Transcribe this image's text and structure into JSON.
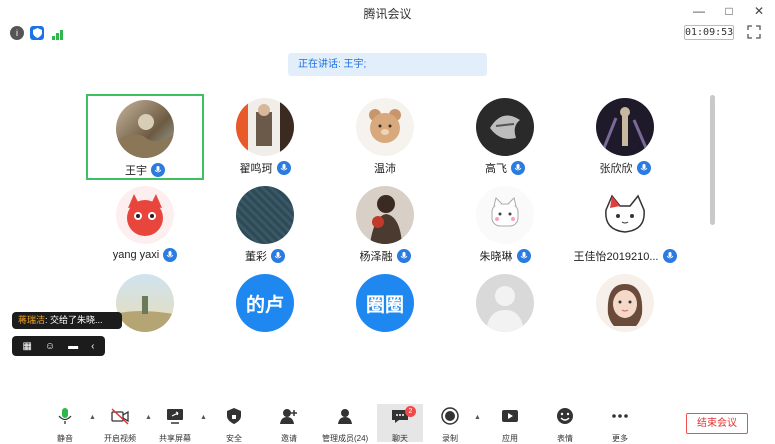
{
  "window": {
    "title": "腾讯会议",
    "minimize": "—",
    "maximize": "□",
    "close": "✕"
  },
  "meeting": {
    "duration": "01:09:53",
    "speaking_label": "正在讲话: 王宇;"
  },
  "participants": [
    {
      "name": "王宇",
      "active": true
    },
    {
      "name": "翟鸣珂"
    },
    {
      "name": "温沛"
    },
    {
      "name": "高飞"
    },
    {
      "name": "张欣欣"
    },
    {
      "name": "yang yaxi"
    },
    {
      "name": "董彩"
    },
    {
      "name": "杨泽融"
    },
    {
      "name": "朱晓琳"
    },
    {
      "name": "王佳怡2019210..."
    },
    {
      "name": "",
      "avatar_text": ""
    },
    {
      "name": "",
      "avatar_text": "的卢"
    },
    {
      "name": "",
      "avatar_text": "圈圈"
    },
    {
      "name": "",
      "avatar_text": ""
    },
    {
      "name": "",
      "avatar_text": ""
    }
  ],
  "chat_toast": {
    "sender": "蒋瑞洁",
    "message": ": 交给了朱晓..."
  },
  "toolbar": {
    "mute": "静音",
    "video": "开启视频",
    "share": "共享屏幕",
    "security": "安全",
    "invite": "邀请",
    "members": "管理成员(24)",
    "chat": "聊天",
    "chat_badge": "2",
    "record": "录制",
    "apps": "应用",
    "reactions": "表情",
    "more": "更多",
    "end": "结束会议"
  },
  "colors": {
    "accent": "#2b7be0",
    "active_border": "#3cc060",
    "end_red": "#e03434"
  }
}
